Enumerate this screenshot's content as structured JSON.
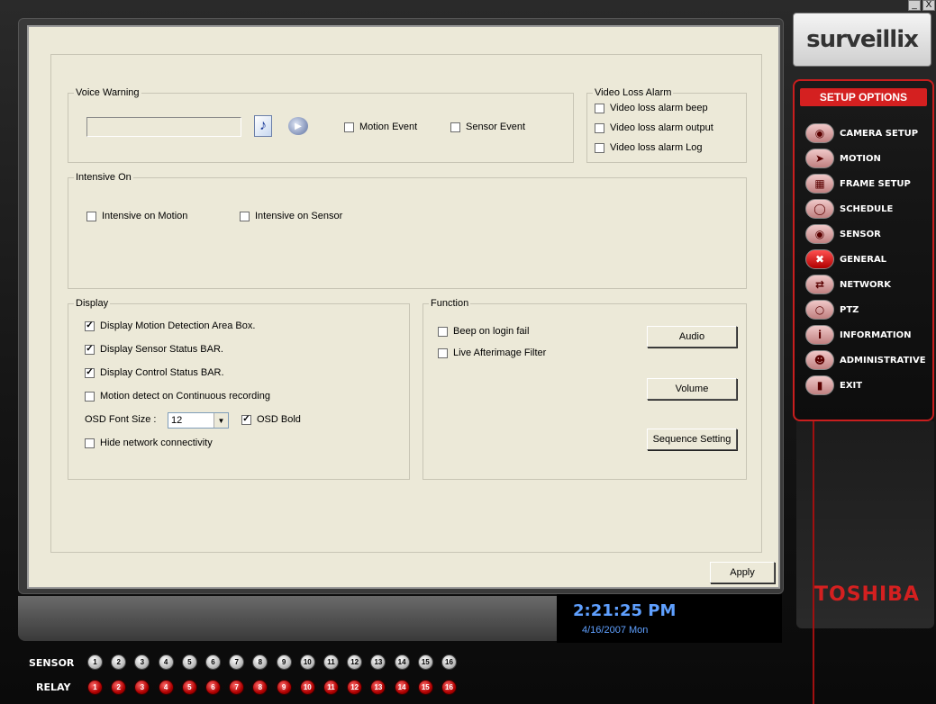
{
  "window": {
    "minimize_label": "_",
    "close_label": "X"
  },
  "brand": {
    "logo": "surveillix",
    "maker": "TOSHIBA"
  },
  "voice_warning": {
    "legend": "Voice Warning",
    "file_value": "",
    "motion_event": "Motion Event",
    "sensor_event": "Sensor Event",
    "motion_checked": false,
    "sensor_checked": false
  },
  "video_loss": {
    "legend": "Video Loss Alarm",
    "items": [
      "Video loss alarm beep",
      "Video loss alarm output",
      "Video loss alarm Log"
    ]
  },
  "intensive": {
    "legend": "Intensive On",
    "motion": "Intensive on Motion",
    "sensor": "Intensive on Sensor"
  },
  "display": {
    "legend": "Display",
    "items": [
      {
        "label": "Display Motion Detection Area Box.",
        "checked": true
      },
      {
        "label": "Display Sensor Status BAR.",
        "checked": true
      },
      {
        "label": "Display Control Status BAR.",
        "checked": true
      },
      {
        "label": "Motion detect on Continuous recording",
        "checked": false
      }
    ],
    "osd_font_label": "OSD Font Size :",
    "osd_font_value": "12",
    "osd_bold": "OSD Bold",
    "hide_network": "Hide network connectivity"
  },
  "function": {
    "legend": "Function",
    "beep": "Beep on login fail",
    "afterimage": "Live Afterimage Filter",
    "audio_btn": "Audio",
    "volume_btn": "Volume",
    "sequence_btn": "Sequence Setting"
  },
  "apply_btn": "Apply",
  "menu": {
    "title": "SETUP OPTIONS",
    "items": [
      {
        "label": "CAMERA SETUP",
        "icon": "camera-icon"
      },
      {
        "label": "MOTION",
        "icon": "running-man-icon"
      },
      {
        "label": "FRAME SETUP",
        "icon": "film-frame-icon"
      },
      {
        "label": "SCHEDULE",
        "icon": "schedule-icon"
      },
      {
        "label": "SENSOR",
        "icon": "sensor-icon"
      },
      {
        "label": "GENERAL",
        "icon": "general-icon"
      },
      {
        "label": "NETWORK",
        "icon": "network-icon"
      },
      {
        "label": "PTZ",
        "icon": "ptz-icon"
      },
      {
        "label": "INFORMATION",
        "icon": "information-icon"
      },
      {
        "label": "ADMINISTRATIVE",
        "icon": "administrative-icon"
      },
      {
        "label": "EXIT",
        "icon": "exit-icon"
      }
    ]
  },
  "clock": {
    "time": "2:21:25 PM",
    "date": "4/16/2007 Mon"
  },
  "status": {
    "sensor_label": "SENSOR",
    "relay_label": "RELAY",
    "channels": [
      "1",
      "2",
      "3",
      "4",
      "5",
      "6",
      "7",
      "8",
      "9",
      "10",
      "11",
      "12",
      "13",
      "14",
      "15",
      "16"
    ]
  },
  "colors": {
    "accent_red": "#d42020",
    "clock_blue": "#5fa0ff",
    "panel_bg": "#ece9d8"
  }
}
